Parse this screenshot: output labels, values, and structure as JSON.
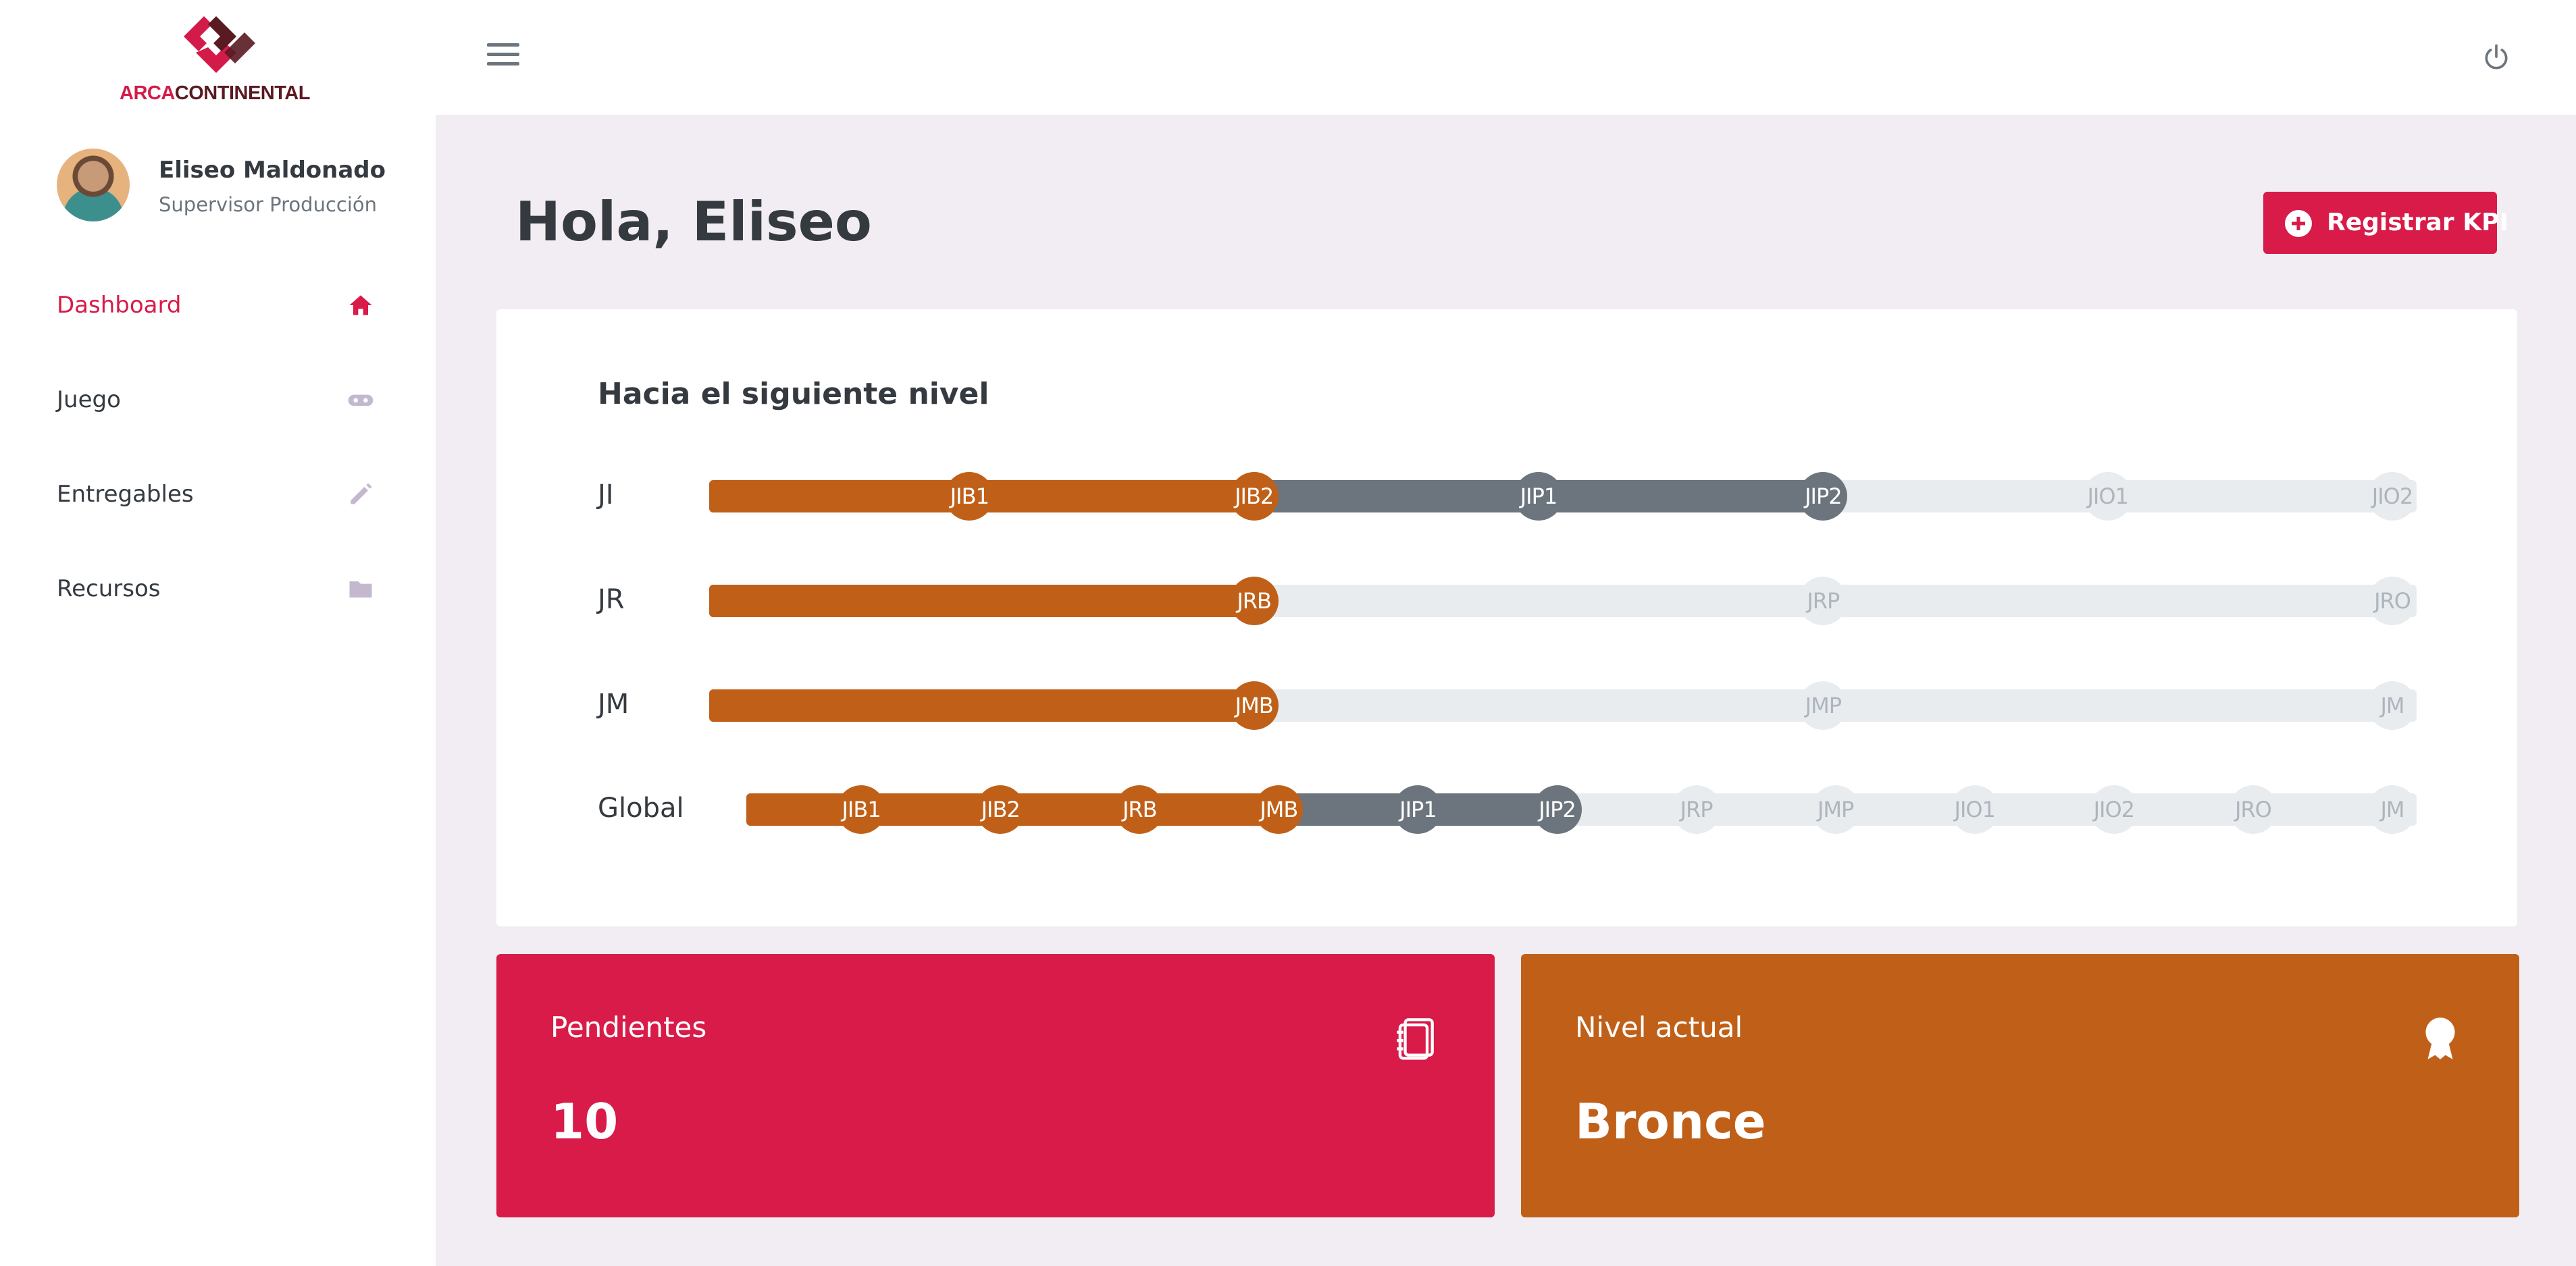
{
  "brand": {
    "logo_text_a": "ARCA",
    "logo_text_b": "CONTINENTAL",
    "primary": "#d81b48",
    "secondary": "#c06018",
    "dark": "#6c757d"
  },
  "user": {
    "name": "Eliseo Maldonado",
    "role": "Supervisor Producción"
  },
  "sidebar": {
    "items": [
      {
        "label": "Dashboard",
        "icon": "home-icon",
        "active": true
      },
      {
        "label": "Juego",
        "icon": "gamepad-icon",
        "active": false
      },
      {
        "label": "Entregables",
        "icon": "pencil-icon",
        "active": false
      },
      {
        "label": "Recursos",
        "icon": "folder-icon",
        "active": false
      }
    ]
  },
  "header": {
    "menu_icon": "hamburger-menu-icon",
    "power_icon": "power-icon"
  },
  "main": {
    "greeting": "Hola, Eliseo",
    "kpi_button_label": "Registrar KPI"
  },
  "progress_card": {
    "title": "Hacia el siguiente nivel",
    "rows": [
      {
        "label": "JI",
        "nodes": [
          {
            "label": "JIB1",
            "state": "bronze"
          },
          {
            "label": "JIB2",
            "state": "bronze"
          },
          {
            "label": "JIP1",
            "state": "silver"
          },
          {
            "label": "JIP2",
            "state": "silver"
          },
          {
            "label": "JIO1",
            "state": "pending"
          },
          {
            "label": "JIO2",
            "state": "pending"
          }
        ]
      },
      {
        "label": "JR",
        "nodes": [
          {
            "label": "JRB",
            "state": "bronze"
          },
          {
            "label": "JRP",
            "state": "pending"
          },
          {
            "label": "JRO",
            "state": "pending"
          }
        ]
      },
      {
        "label": "JM",
        "nodes": [
          {
            "label": "JMB",
            "state": "bronze"
          },
          {
            "label": "JMP",
            "state": "pending"
          },
          {
            "label": "JM",
            "state": "pending"
          }
        ]
      },
      {
        "label": "Global",
        "nodes": [
          {
            "label": "JIB1",
            "state": "bronze"
          },
          {
            "label": "JIB2",
            "state": "bronze"
          },
          {
            "label": "JRB",
            "state": "bronze"
          },
          {
            "label": "JMB",
            "state": "bronze"
          },
          {
            "label": "JIP1",
            "state": "silver"
          },
          {
            "label": "JIP2",
            "state": "silver"
          },
          {
            "label": "JRP",
            "state": "pending"
          },
          {
            "label": "JMP",
            "state": "pending"
          },
          {
            "label": "JIO1",
            "state": "pending"
          },
          {
            "label": "JIO2",
            "state": "pending"
          },
          {
            "label": "JRO",
            "state": "pending"
          },
          {
            "label": "JM",
            "state": "pending"
          }
        ]
      }
    ]
  },
  "stats": [
    {
      "title": "Pendientes",
      "value": "10",
      "icon": "notebook-icon",
      "color": "#d81b48"
    },
    {
      "title": "Nivel actual",
      "value": "Bronce",
      "icon": "award-icon",
      "color": "#c06018"
    }
  ]
}
